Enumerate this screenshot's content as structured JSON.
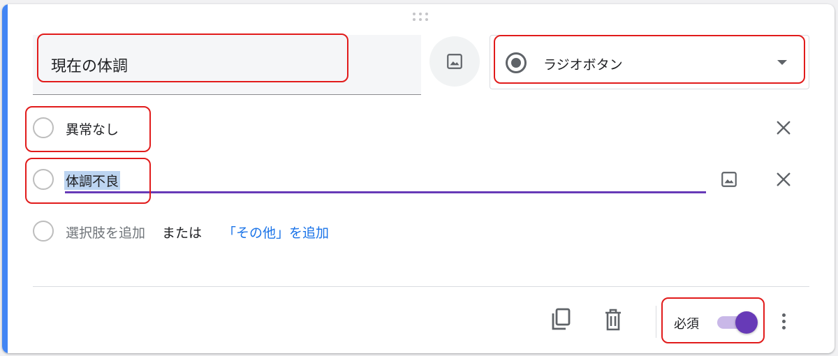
{
  "question": {
    "title": "現在の体調",
    "type_label": "ラジオボタン"
  },
  "options": [
    {
      "label": "異常なし"
    },
    {
      "label": "体調不良"
    }
  ],
  "add_option": {
    "label": "選択肢を追加",
    "or_text": "または",
    "other_link": "「その他」を追加"
  },
  "footer": {
    "required_label": "必須",
    "required_on": true
  },
  "icons": {
    "image": "image-icon",
    "close": "close-icon",
    "duplicate": "copy-icon",
    "delete": "trash-icon",
    "more": "more-vert-icon",
    "drag": "drag-handle-icon",
    "dropdown": "chevron-down-icon"
  },
  "colors": {
    "accent": "#4285f4",
    "toggle": "#673ab7",
    "link": "#1a73e8",
    "highlight": "#e11b1b"
  }
}
